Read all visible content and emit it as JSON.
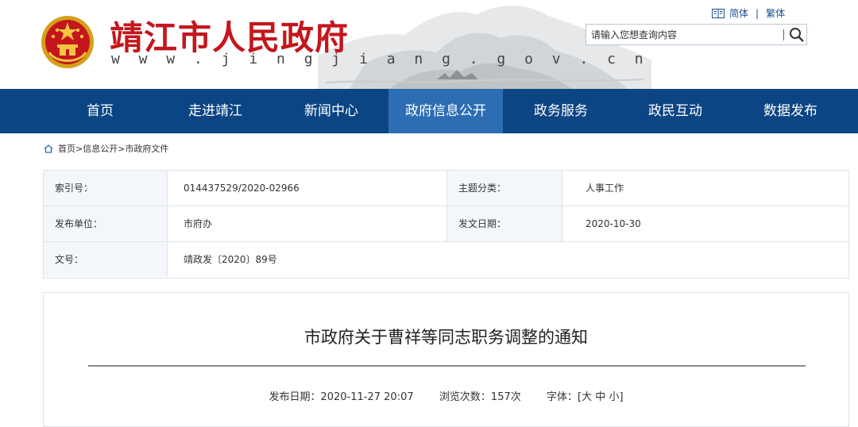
{
  "header": {
    "site_title": "靖江市人民政府",
    "site_url": "w w w . j i n g j i a n g . g o v . c n",
    "lang_simplified": "简体",
    "lang_separator": "|",
    "lang_traditional": "繁体",
    "search_placeholder": "请输入您想查询内容"
  },
  "nav": {
    "items": [
      {
        "label": "首页"
      },
      {
        "label": "走进靖江"
      },
      {
        "label": "新闻中心"
      },
      {
        "label": "政府信息公开"
      },
      {
        "label": "政务服务"
      },
      {
        "label": "政民互动"
      },
      {
        "label": "数据发布"
      }
    ],
    "active_index": 3
  },
  "breadcrumb": {
    "home": "首页",
    "sep1": ">",
    "level1": "信息公开",
    "sep2": ">",
    "level2": "市政府文件"
  },
  "meta": {
    "index_label": "索引号：",
    "index_value": "014437529/2020-02966",
    "topic_label": "主题分类：",
    "topic_value": "人事工作",
    "publisher_label": "发布单位：",
    "publisher_value": "市府办",
    "doc_date_label": "发文日期：",
    "doc_date_value": "2020-10-30",
    "doc_no_label": "文号：",
    "doc_no_value": "靖政发〔2020〕89号"
  },
  "article": {
    "title": "市政府关于曹祥等同志职务调整的通知",
    "publish_label": "发布日期：",
    "publish_value": "2020-11-27 20:07",
    "views_label": "浏览次数：",
    "views_value": "157次",
    "font_label": "字体：",
    "font_open": "[",
    "font_large": "大",
    "font_medium": "中",
    "font_small": "小",
    "font_close": "]"
  },
  "colors": {
    "brand_red": "#c4161c",
    "nav_blue": "#0c4583",
    "nav_active": "#2d6db4",
    "link_blue": "#1e4e8c"
  },
  "icons": [
    "national-emblem-icon",
    "book-icon",
    "search-icon",
    "home-icon"
  ]
}
